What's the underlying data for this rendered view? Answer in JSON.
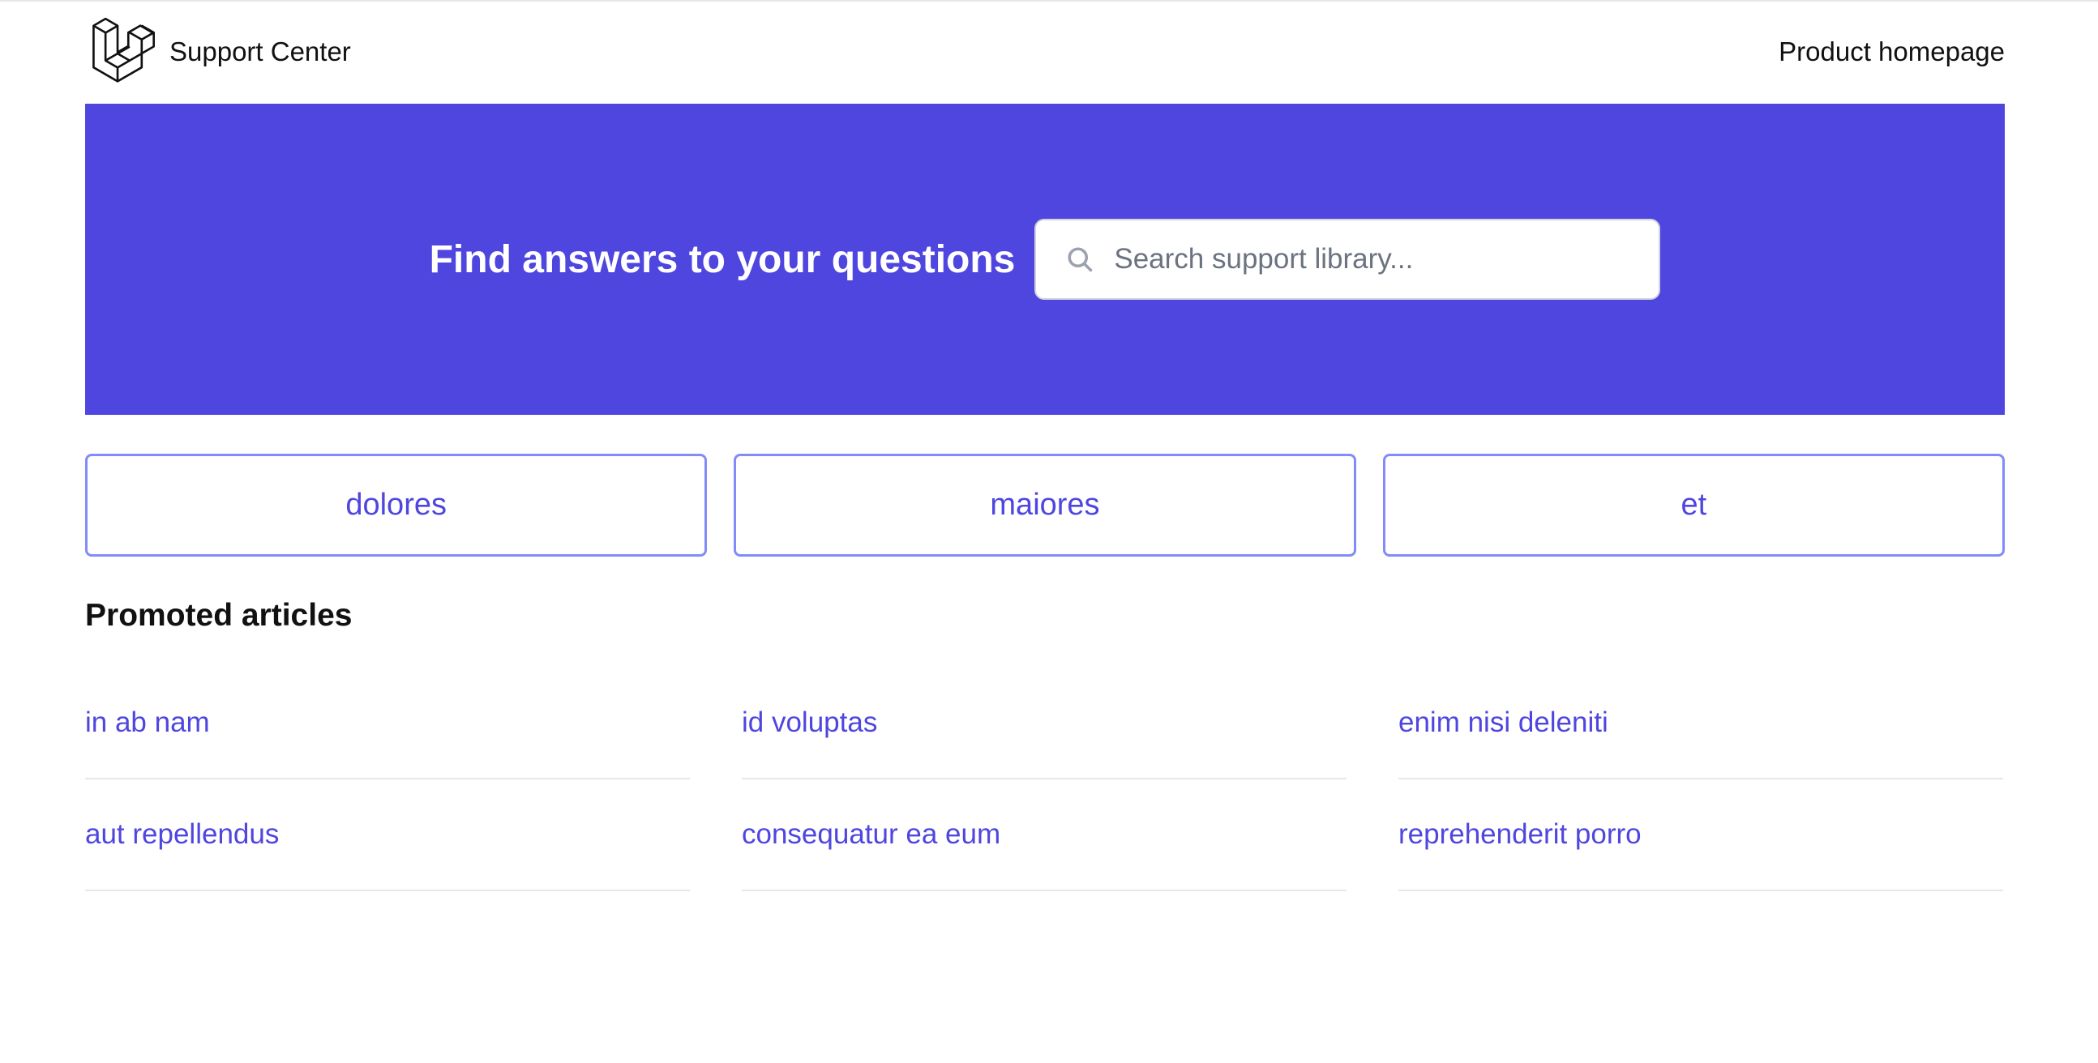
{
  "header": {
    "brand_name": "Support Center",
    "product_link": "Product homepage",
    "logo_icon": "laravel-logo-icon"
  },
  "hero": {
    "title": "Find answers to your questions",
    "search": {
      "placeholder": "Search support library...",
      "value": "",
      "icon": "search-icon"
    },
    "background_color": "#4f46e0"
  },
  "categories": [
    {
      "label": "dolores"
    },
    {
      "label": "maiores"
    },
    {
      "label": "et"
    }
  ],
  "promoted": {
    "title": "Promoted articles",
    "articles": [
      {
        "label": "in ab nam"
      },
      {
        "label": "id voluptas"
      },
      {
        "label": "enim nisi deleniti"
      },
      {
        "label": "aut repellendus"
      },
      {
        "label": "consequatur ea eum"
      },
      {
        "label": "reprehenderit porro"
      }
    ]
  },
  "colors": {
    "accent": "#4f46e0",
    "category_border": "#818cf8",
    "divider": "#e5e7eb"
  }
}
